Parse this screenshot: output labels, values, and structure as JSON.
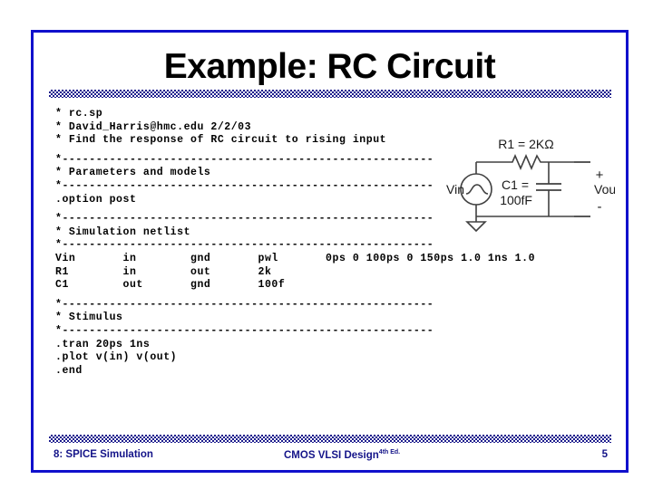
{
  "slide": {
    "title": "Example: RC Circuit"
  },
  "code": {
    "lines": [
      "* rc.sp",
      "* David_Harris@hmc.edu 2/2/03",
      "* Find the response of RC circuit to rising input",
      "",
      "*-------------------------------------------------------",
      "* Parameters and models",
      "*-------------------------------------------------------",
      ".option post",
      "",
      "*-------------------------------------------------------",
      "* Simulation netlist",
      "*-------------------------------------------------------",
      "Vin       in        gnd       pwl       0ps 0 100ps 0 150ps 1.0 1ns 1.0",
      "R1        in        out       2k",
      "C1        out       gnd       100f",
      "",
      "*-------------------------------------------------------",
      "* Stimulus",
      "*-------------------------------------------------------",
      ".tran 20ps 1ns",
      ".plot v(in) v(out)",
      ".end"
    ]
  },
  "circuit": {
    "resistor_label": "R1 = 2KΩ",
    "capacitor_label_line1": "C1 =",
    "capacitor_label_line2": "100fF",
    "source_label": "Vin",
    "output_label": "Vout",
    "plus_label": "+",
    "minus_label": "-"
  },
  "footer": {
    "section": "8: SPICE Simulation",
    "book": "CMOS VLSI Design",
    "edition": "4th Ed.",
    "page": "5"
  },
  "colors": {
    "frame_blue": "#1010CC",
    "footer_navy": "#141489",
    "checker_navy": "#1a1a8c"
  }
}
